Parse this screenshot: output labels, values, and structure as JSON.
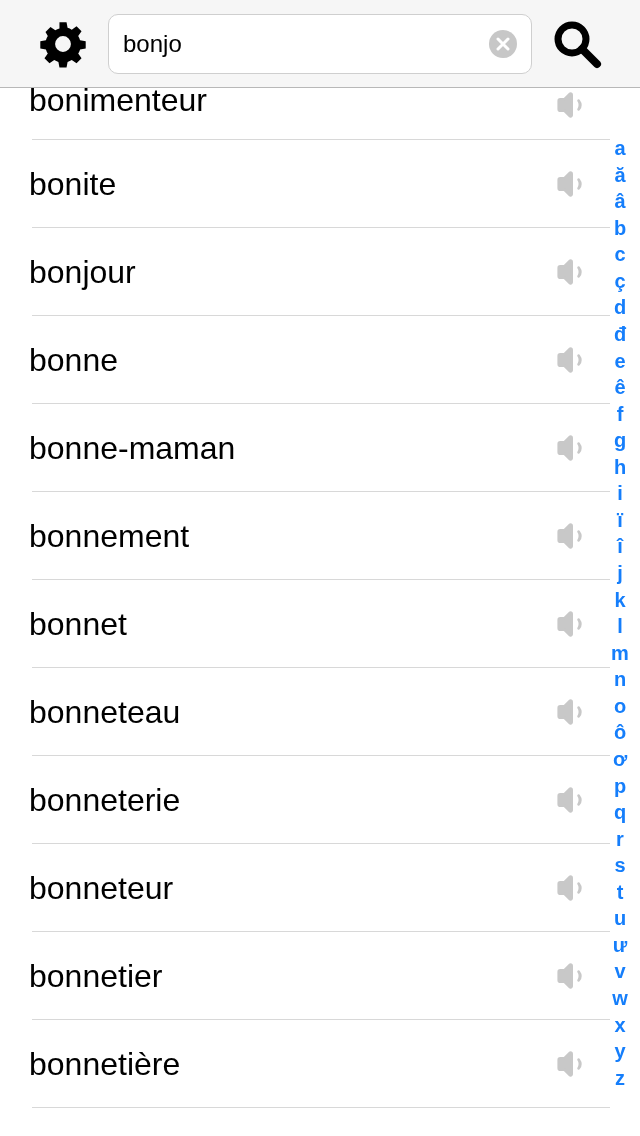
{
  "search": {
    "value": "bonjo"
  },
  "words": [
    "bonimenteur",
    "bonite",
    "bonjour",
    "bonne",
    "bonne-maman",
    "bonnement",
    "bonnet",
    "bonneteau",
    "bonneterie",
    "bonneteur",
    "bonnetier",
    "bonnetière"
  ],
  "index": [
    "a",
    "ă",
    "â",
    "b",
    "c",
    "ç",
    "d",
    "đ",
    "e",
    "ê",
    "f",
    "g",
    "h",
    "i",
    "ï",
    "î",
    "j",
    "k",
    "l",
    "m",
    "n",
    "o",
    "ô",
    "ơ",
    "p",
    "q",
    "r",
    "s",
    "t",
    "u",
    "ư",
    "v",
    "w",
    "x",
    "y",
    "z"
  ]
}
